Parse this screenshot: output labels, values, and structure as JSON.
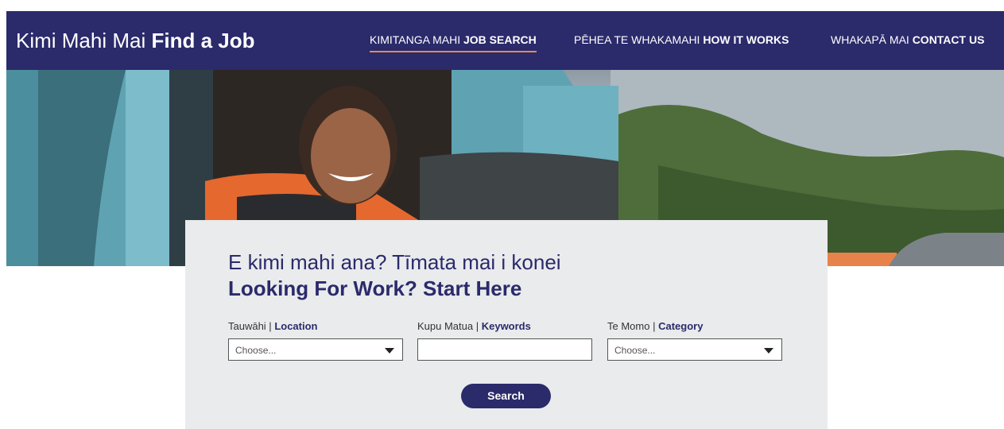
{
  "header": {
    "brand_light": "Kimi Mahi Mai",
    "brand_bold": "Find a Job",
    "nav": [
      {
        "light": "KIMITANGA MAHI",
        "bold": "JOB SEARCH"
      },
      {
        "light": "PĒHEA TE WHAKAMAHI",
        "bold": "HOW IT WORKS"
      },
      {
        "light": "WHAKAPĀ MAI",
        "bold": "CONTACT US"
      }
    ]
  },
  "search": {
    "heading_reo": "E kimi mahi ana? Tīmata mai i konei",
    "heading_en": "Looking For Work? Start Here",
    "location": {
      "label_reo": "Tauwāhi |",
      "label_en": "Location",
      "value": "Choose..."
    },
    "keywords": {
      "label_reo": "Kupu Matua |",
      "label_en": "Keywords",
      "value": ""
    },
    "category": {
      "label_reo": "Te Momo |",
      "label_en": "Category",
      "value": "Choose..."
    },
    "button": "Search"
  },
  "colors": {
    "navy": "#2b2a6b",
    "accent": "#e58a52",
    "panel": "#e9ebec"
  }
}
